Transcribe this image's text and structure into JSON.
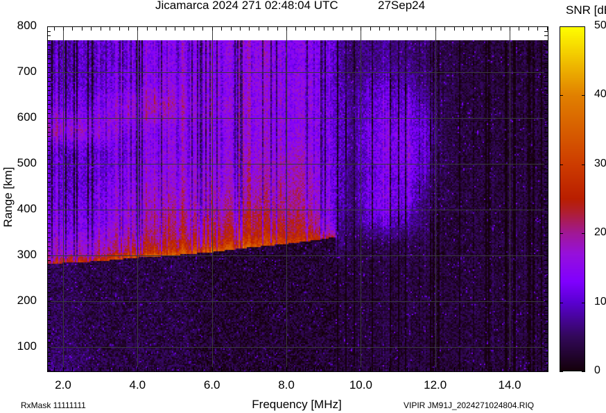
{
  "header": {
    "title": "Jicamarca 2024 271 02:48:04 UTC",
    "date": "27Sep24",
    "colorbar_title": "SNR [dB]"
  },
  "footer": {
    "rxmask": "RxMask 11111111",
    "filename": "VIPIR  JM91J_2024271024804.RIQ"
  },
  "chart_data": {
    "type": "heatmap",
    "title": "Jicamarca 2024 271 02:48:04 UTC",
    "xlabel": "Frequency [MHz]",
    "ylabel": "Range [km]",
    "xlim": [
      1.57,
      15.0
    ],
    "ylim": [
      47,
      800
    ],
    "data_top_km": 770,
    "grid": true,
    "x_ticks": [
      "2.0",
      "4.0",
      "6.0",
      "8.0",
      "10.0",
      "12.0",
      "14.0"
    ],
    "x_tick_values": [
      2,
      4,
      6,
      8,
      10,
      12,
      14
    ],
    "y_ticks": [
      "800",
      "700",
      "600",
      "500",
      "400",
      "300",
      "200",
      "100"
    ],
    "y_tick_values": [
      800,
      700,
      600,
      500,
      400,
      300,
      200,
      100
    ],
    "colorbar": {
      "label": "SNR [dB]",
      "range": [
        0,
        50
      ],
      "ticks": [
        "0",
        "10",
        "20",
        "30",
        "40",
        "50"
      ],
      "tick_values": [
        0,
        10,
        20,
        30,
        40,
        50
      ],
      "colormap_stops": [
        [
          0,
          "#14000a"
        ],
        [
          5,
          "#32085a"
        ],
        [
          10,
          "#5a00d2"
        ],
        [
          13,
          "#8000ff"
        ],
        [
          17,
          "#9610dc"
        ],
        [
          20,
          "#a01896"
        ],
        [
          23,
          "#af1e32"
        ],
        [
          25,
          "#b91e00"
        ],
        [
          30,
          "#cd3c00"
        ],
        [
          40,
          "#e18000"
        ],
        [
          50,
          "#ffff00"
        ]
      ]
    },
    "freq_bins_mhz": [
      1.75,
      2.25,
      2.75,
      3.25,
      3.75,
      4.25,
      4.75,
      5.25,
      5.75,
      6.25,
      6.75,
      7.25,
      7.75,
      8.25,
      8.75,
      9.25,
      9.75,
      10.25,
      10.75,
      11.25,
      11.75,
      12.25,
      12.75,
      13.25,
      13.75,
      14.25,
      14.75
    ],
    "range_bins_km": [
      775,
      725,
      675,
      625,
      575,
      525,
      475,
      425,
      375,
      325,
      275,
      225,
      175,
      125,
      75
    ],
    "snr_db": [
      [
        8,
        9,
        10,
        10,
        11,
        13,
        14,
        14,
        14,
        15,
        15,
        15,
        14,
        14,
        14,
        10,
        5,
        7,
        7,
        6,
        5,
        4,
        3,
        3,
        3,
        3,
        3
      ],
      [
        8,
        9,
        10,
        10,
        11,
        13,
        14,
        14,
        14,
        15,
        15,
        15,
        14,
        14,
        14,
        10,
        5,
        7,
        7,
        6,
        5,
        4,
        3,
        3,
        3,
        3,
        3
      ],
      [
        9,
        10,
        10,
        11,
        12,
        14,
        15,
        15,
        15,
        15,
        15,
        15,
        15,
        15,
        15,
        10,
        6,
        9,
        9,
        8,
        6,
        4,
        3,
        3,
        3,
        3,
        3
      ],
      [
        12,
        12,
        13,
        14,
        16,
        18,
        19,
        17,
        16,
        16,
        16,
        15,
        15,
        15,
        15,
        11,
        7,
        11,
        11,
        11,
        8,
        4,
        3,
        3,
        3,
        3,
        3
      ],
      [
        17,
        18,
        16,
        15,
        13,
        14,
        15,
        15,
        15,
        15,
        15,
        15,
        15,
        15,
        15,
        11,
        7,
        12,
        13,
        12,
        10,
        4,
        3,
        3,
        3,
        3,
        3
      ],
      [
        9,
        10,
        11,
        11,
        12,
        14,
        15,
        15,
        15,
        16,
        16,
        16,
        16,
        17,
        16,
        11,
        7,
        12,
        13,
        13,
        9,
        4,
        3,
        3,
        3,
        3,
        3
      ],
      [
        10,
        10,
        11,
        12,
        13,
        15,
        16,
        16,
        17,
        17,
        17,
        18,
        18,
        19,
        17,
        11,
        6,
        11,
        12,
        12,
        8,
        4,
        3,
        3,
        3,
        3,
        3
      ],
      [
        11,
        11,
        12,
        13,
        15,
        17,
        18,
        18,
        18,
        19,
        19,
        19,
        19,
        20,
        18,
        11,
        6,
        12,
        13,
        11,
        6,
        4,
        3,
        3,
        3,
        3,
        3
      ],
      [
        12,
        12,
        13,
        14,
        16,
        18,
        20,
        20,
        21,
        21,
        22,
        22,
        22,
        22,
        20,
        10,
        5,
        10,
        10,
        8,
        5,
        3,
        3,
        3,
        3,
        3,
        3
      ],
      [
        14,
        14,
        15,
        16,
        17,
        19,
        20,
        21,
        21,
        22,
        22,
        22,
        22,
        21,
        19,
        7,
        4,
        4,
        4,
        4,
        4,
        3,
        3,
        3,
        3,
        3,
        3
      ],
      [
        5,
        5,
        5,
        4,
        4,
        4,
        4,
        4,
        3,
        3,
        3,
        3,
        3,
        3,
        3,
        3,
        3,
        3,
        3,
        3,
        3,
        3,
        3,
        3,
        3,
        3,
        3
      ],
      [
        5,
        5,
        4,
        4,
        4,
        4,
        4,
        4,
        3,
        3,
        3,
        3,
        3,
        3,
        3,
        3,
        3,
        3,
        3,
        3,
        3,
        3,
        3,
        3,
        3,
        3,
        3
      ],
      [
        5,
        5,
        4,
        4,
        4,
        4,
        4,
        4,
        3,
        3,
        3,
        3,
        3,
        3,
        3,
        3,
        3,
        3,
        3,
        3,
        3,
        3,
        3,
        3,
        3,
        3,
        3
      ],
      [
        5,
        5,
        4,
        4,
        4,
        4,
        4,
        4,
        3,
        3,
        3,
        3,
        3,
        3,
        3,
        3,
        3,
        3,
        3,
        3,
        3,
        3,
        3,
        3,
        3,
        3,
        3
      ],
      [
        6,
        6,
        5,
        4,
        4,
        4,
        4,
        4,
        3,
        3,
        3,
        3,
        3,
        3,
        3,
        3,
        3,
        3,
        3,
        3,
        3,
        3,
        3,
        3,
        3,
        3,
        3
      ]
    ],
    "f_trace": {
      "freq_mhz": [
        1.6,
        2.0,
        3.0,
        4.0,
        5.0,
        6.0,
        7.0,
        8.0,
        8.8,
        9.3
      ],
      "virtual_height_km": [
        285,
        288,
        292,
        300,
        305,
        312,
        322,
        330,
        338,
        345
      ],
      "snr_db": [
        24,
        26,
        28,
        32,
        34,
        35,
        33,
        30,
        28,
        20
      ]
    }
  }
}
